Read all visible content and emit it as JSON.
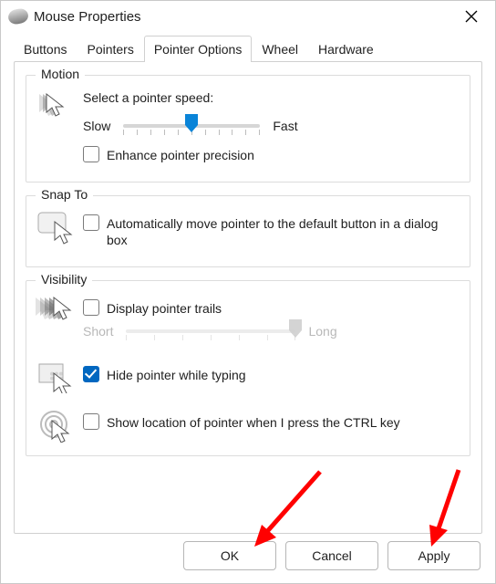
{
  "title": "Mouse Properties",
  "tabs": [
    "Buttons",
    "Pointers",
    "Pointer Options",
    "Wheel",
    "Hardware"
  ],
  "active_tab": 2,
  "groups": {
    "motion": {
      "title": "Motion",
      "select_label": "Select a pointer speed:",
      "slow_label": "Slow",
      "fast_label": "Fast",
      "speed_value": 5,
      "speed_ticks": 11,
      "enhance_label": "Enhance pointer precision",
      "enhance_checked": false
    },
    "snap": {
      "title": "Snap To",
      "auto_label": "Automatically move pointer to the default button in a dialog box",
      "auto_checked": false
    },
    "visibility": {
      "title": "Visibility",
      "trails_label": "Display pointer trails",
      "trails_checked": false,
      "trails_short_label": "Short",
      "trails_long_label": "Long",
      "trails_value": 6,
      "trails_ticks": 7,
      "hide_label": "Hide pointer while typing",
      "hide_checked": true,
      "ctrl_label": "Show location of pointer when I press the CTRL key",
      "ctrl_checked": false
    }
  },
  "buttons": {
    "ok": "OK",
    "cancel": "Cancel",
    "apply": "Apply"
  }
}
